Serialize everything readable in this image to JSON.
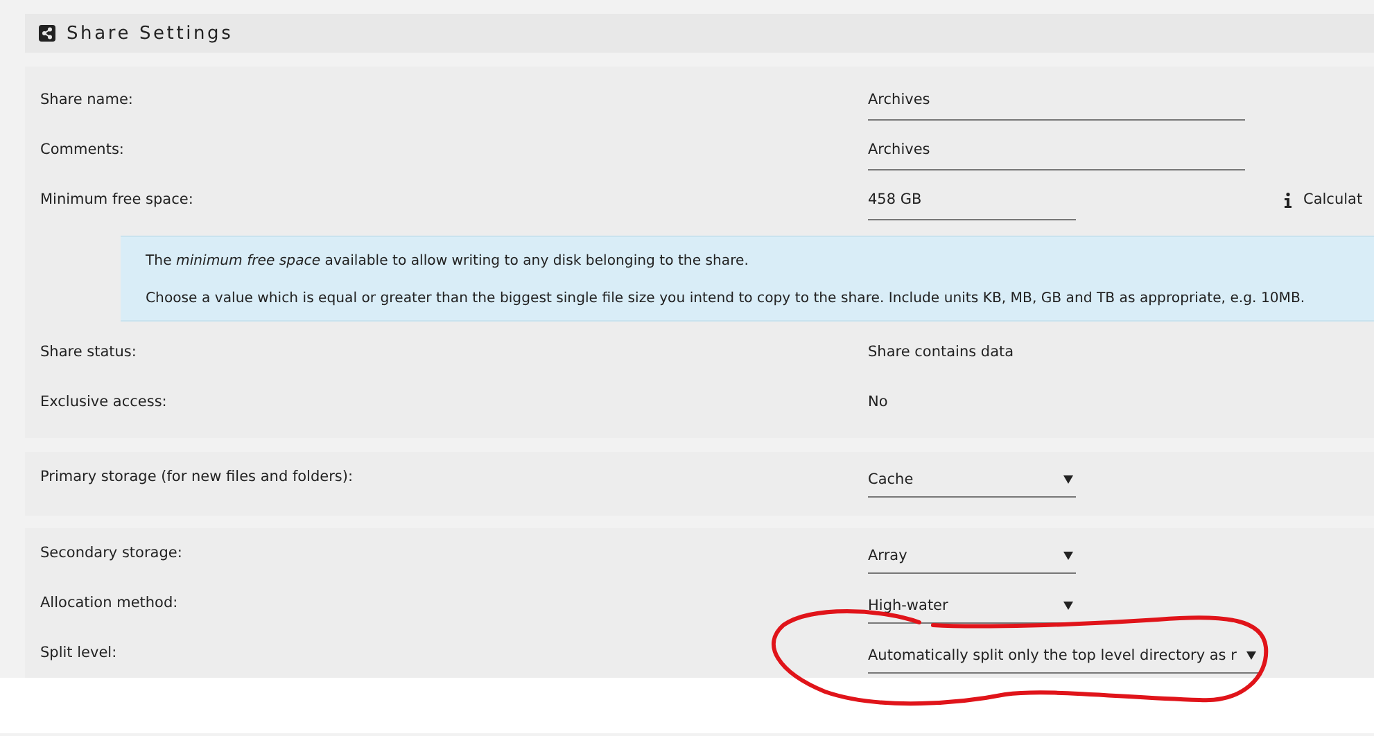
{
  "header": {
    "title": "Share Settings"
  },
  "panels": [
    {
      "rows": [
        {
          "kind": "text",
          "label": "Share name:",
          "value": "Archives"
        },
        {
          "kind": "text",
          "label": "Comments:",
          "value": "Archives"
        },
        {
          "kind": "short",
          "label": "Minimum free space:",
          "value": "458 GB",
          "action": "Calculat"
        },
        {
          "kind": "info",
          "lines": [
            "The *minimum free space* available to allow writing to any disk belonging to the share.",
            "Choose a value which is equal or greater than the biggest single file size you intend to copy to the share. Include units KB, MB, GB and TB as appropriate, e.g. 10MB."
          ]
        },
        {
          "kind": "static",
          "label": "Share status:",
          "value": "Share contains data"
        },
        {
          "kind": "static",
          "label": "Exclusive access:",
          "value": "No"
        }
      ]
    },
    {
      "rows": [
        {
          "kind": "select",
          "label": "Primary storage (for new files and folders):",
          "value": "Cache"
        }
      ]
    },
    {
      "rows": [
        {
          "kind": "select",
          "label": "Secondary storage:",
          "value": "Array"
        },
        {
          "kind": "select",
          "label": "Allocation method:",
          "value": "High-water"
        },
        {
          "kind": "wideselect",
          "label": "Split level:",
          "value": "Automatically split only the top level directory as r",
          "circled": true
        }
      ]
    }
  ]
}
